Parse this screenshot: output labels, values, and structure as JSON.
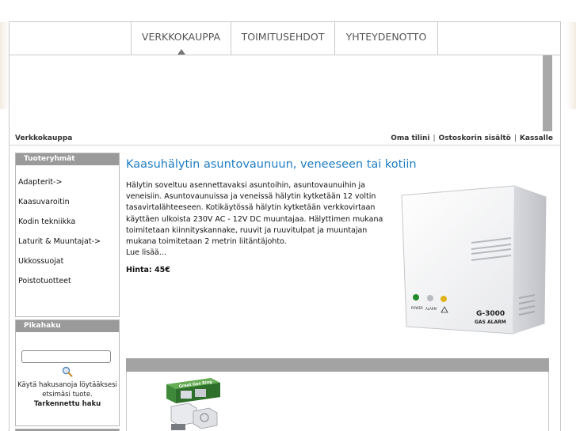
{
  "topnav": {
    "items": [
      {
        "label": "VERKKOKAUPPA"
      },
      {
        "label": "TOIMITUSEHDOT"
      },
      {
        "label": "YHTEYDENOTTO"
      }
    ]
  },
  "breadcrumb": {
    "label": "Verkkokauppa"
  },
  "user_links": {
    "account": "Oma tilini",
    "cart": "Ostoskorin sisältö",
    "checkout": "Kassalle",
    "separator": "|"
  },
  "categories": {
    "title": "Tuoteryhmät",
    "items": [
      "Adapterit->",
      "Kaasuvaroitin",
      "Kodin tekniikka",
      "Laturit & Muuntajat->",
      "Ukkossuojat",
      "Poistotuotteet"
    ]
  },
  "quick_search": {
    "title": "Pikahaku",
    "placeholder": "",
    "help_text": "Käytä hakusanoja löytääksesi etsimäsi tuote.",
    "advanced_link": "Tarkennettu haku"
  },
  "product": {
    "title": "Kaasuhälytin asuntovaunuun, veneeseen tai kotiin",
    "description": "Hälytin soveltuu asennettavaksi asuntoihin, asuntovaunuihin ja veneisiin. Asuntovaunuissa ja veneissä hälytin kytketään 12 voltin tasavirtalähteeseen. Kotikäytössä hälytin kytketään verkkovirtaan käyttäen ulkoista 230V AC - 12V DC muuntajaa. Hälyttimen mukana toimitetaan kiinnityskannake, ruuvit ja ruuvitulpat ja muuntajan mukana toimitetaan 2 metrin liitäntäjohto.",
    "read_more": "Lue lisää...",
    "price": "Hinta: 45€",
    "image": {
      "model": "G-3000",
      "subtitle": "GAS ALARM",
      "led_power": "POWER",
      "led_alarm": "ALARM"
    }
  },
  "product2": {
    "image_label": "Great Gas Ring"
  }
}
